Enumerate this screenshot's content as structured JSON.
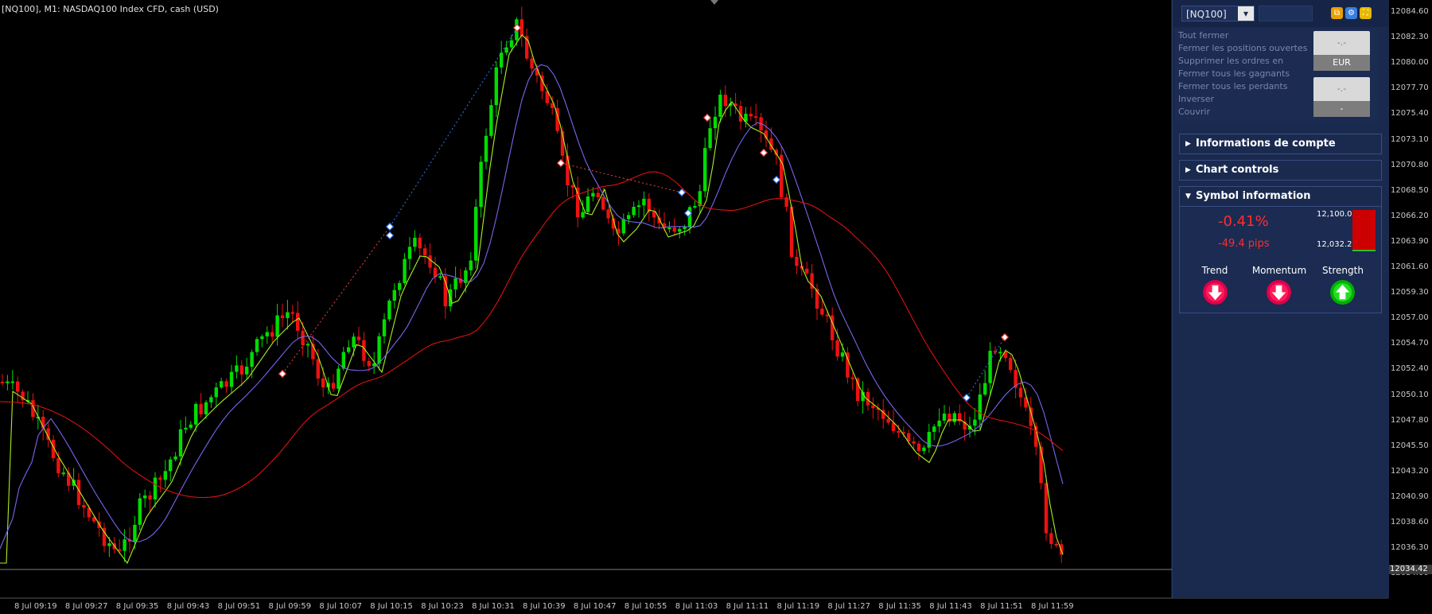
{
  "chart": {
    "title": "[NQ100], M1:  NASDAQ100 Index CFD, cash (USD)",
    "price_labels": [
      "12084.60",
      "12082.30",
      "12080.00",
      "12077.70",
      "12075.40",
      "12073.10",
      "12070.80",
      "12068.50",
      "12066.20",
      "12063.90",
      "12061.60",
      "12059.30",
      "12057.00",
      "12054.70",
      "12052.40",
      "12050.10",
      "12047.80",
      "12045.50",
      "12043.20",
      "12040.90",
      "12038.60",
      "12036.30",
      "12034.00"
    ],
    "current_price": "12034.42",
    "time_labels": [
      "8 Jul 09:19",
      "8 Jul 09:27",
      "8 Jul 09:35",
      "8 Jul 09:43",
      "8 Jul 09:51",
      "8 Jul 09:59",
      "8 Jul 10:07",
      "8 Jul 10:15",
      "8 Jul 10:23",
      "8 Jul 10:31",
      "8 Jul 10:39",
      "8 Jul 10:47",
      "8 Jul 10:55",
      "8 Jul 11:03",
      "8 Jul 11:11",
      "8 Jul 11:19",
      "8 Jul 11:27",
      "8 Jul 11:35",
      "8 Jul 11:43",
      "8 Jul 11:51",
      "8 Jul 11:59"
    ],
    "colors": {
      "bull": "#00dd00",
      "bear": "#ee1111",
      "ma_fast": "#aaee22",
      "ma_mid": "#7766ee",
      "ma_slow": "#dd1111"
    }
  },
  "panel": {
    "symbol": "[NQ100]",
    "trade_links": [
      "Tout fermer",
      "Fermer les positions ouvertes",
      "Supprimer les ordres en",
      "Fermer tous les gagnants",
      "Fermer tous les perdants",
      "Inverser",
      "Couvrir"
    ],
    "btn1_top": "-.-",
    "btn1_bottom": "EUR",
    "btn2_top": "-.-",
    "btn2_bottom": "-",
    "sections": {
      "account": "Informations de compte",
      "chart_controls": "Chart controls",
      "symbol_info": "Symbol information"
    },
    "symbol_info": {
      "change_pct": "-0.41%",
      "change_pips": "-49.4 pips",
      "high": "12,100.03",
      "low": "12,032.22",
      "trend": "Trend",
      "momentum": "Momentum",
      "strength": "Strength"
    }
  }
}
